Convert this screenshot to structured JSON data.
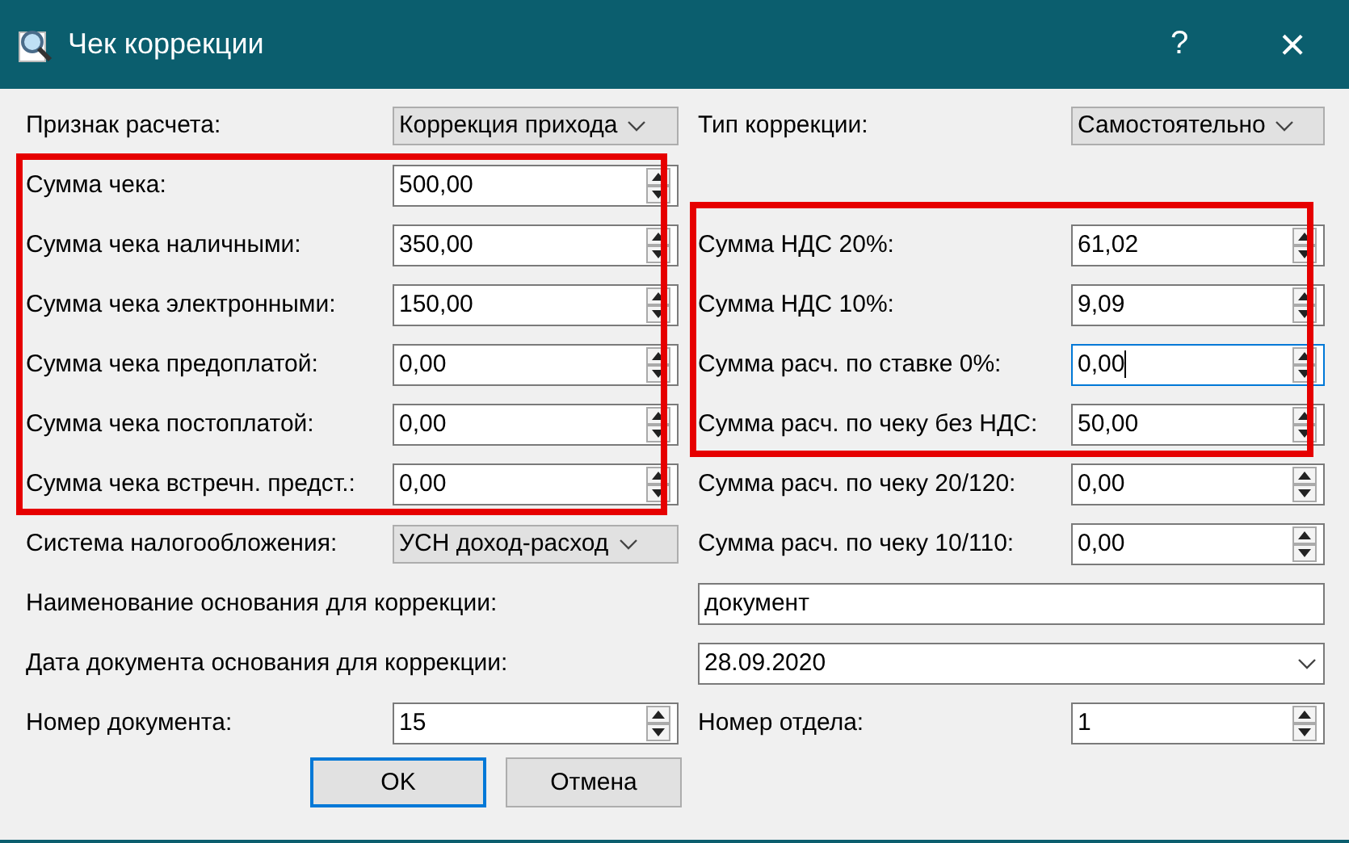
{
  "window": {
    "title": "Чек коррекции",
    "help": "?",
    "close": "×"
  },
  "rows": [
    {
      "left": {
        "label": "Признак расчета:",
        "kind": "combo",
        "value": "Коррекция прихода"
      },
      "right": {
        "label": "Тип коррекции:",
        "kind": "combo",
        "value": "Самостоятельно"
      }
    },
    {
      "left": {
        "label": "Сумма чека:",
        "kind": "spin",
        "value": "500,00",
        "highlighted": true
      }
    },
    {
      "left": {
        "label": "Сумма чека наличными:",
        "kind": "spin",
        "value": "350,00",
        "highlighted": true
      },
      "right": {
        "label": "Сумма НДС 20%:",
        "kind": "spin",
        "value": "61,02",
        "highlighted": true
      }
    },
    {
      "left": {
        "label": "Сумма чека электронными:",
        "kind": "spin",
        "value": "150,00",
        "highlighted": true
      },
      "right": {
        "label": "Сумма НДС 10%:",
        "kind": "spin",
        "value": "9,09",
        "highlighted": true
      }
    },
    {
      "left": {
        "label": "Сумма чека предоплатой:",
        "kind": "spin",
        "value": "0,00",
        "highlighted": true
      },
      "right": {
        "label": "Сумма расч. по ставке 0%:",
        "kind": "spin",
        "value": "0,00",
        "highlighted": true,
        "focused": true
      }
    },
    {
      "left": {
        "label": "Сумма чека постоплатой:",
        "kind": "spin",
        "value": "0,00",
        "highlighted": true
      },
      "right": {
        "label": "Сумма расч. по чеку без НДС:",
        "kind": "spin",
        "value": "50,00",
        "highlighted": true
      }
    },
    {
      "left": {
        "label": "Сумма чека встречн. предст.:",
        "kind": "spin",
        "value": "0,00",
        "highlighted": true
      },
      "right": {
        "label": "Сумма расч. по чеку 20/120:",
        "kind": "spin",
        "value": "0,00"
      }
    },
    {
      "left": {
        "label": "Система налогообложения:",
        "kind": "combo",
        "value": "УСН доход-расход"
      },
      "right": {
        "label": "Сумма расч. по чеку 10/110:",
        "kind": "spin",
        "value": "0,00"
      }
    },
    {
      "wide": {
        "label": "Наименование основания для коррекции:",
        "kind": "text",
        "value": "документ"
      }
    },
    {
      "wide": {
        "label": "Дата документа основания для коррекции:",
        "kind": "date",
        "value": "28.09.2020"
      }
    },
    {
      "left": {
        "label": "Номер документа:",
        "kind": "spin",
        "value": "15"
      },
      "right": {
        "label": "Номер отдела:",
        "kind": "spin",
        "value": "1"
      }
    }
  ],
  "buttons": [
    {
      "label": "OK",
      "default": true
    },
    {
      "label": "Отмена",
      "default": false
    }
  ]
}
